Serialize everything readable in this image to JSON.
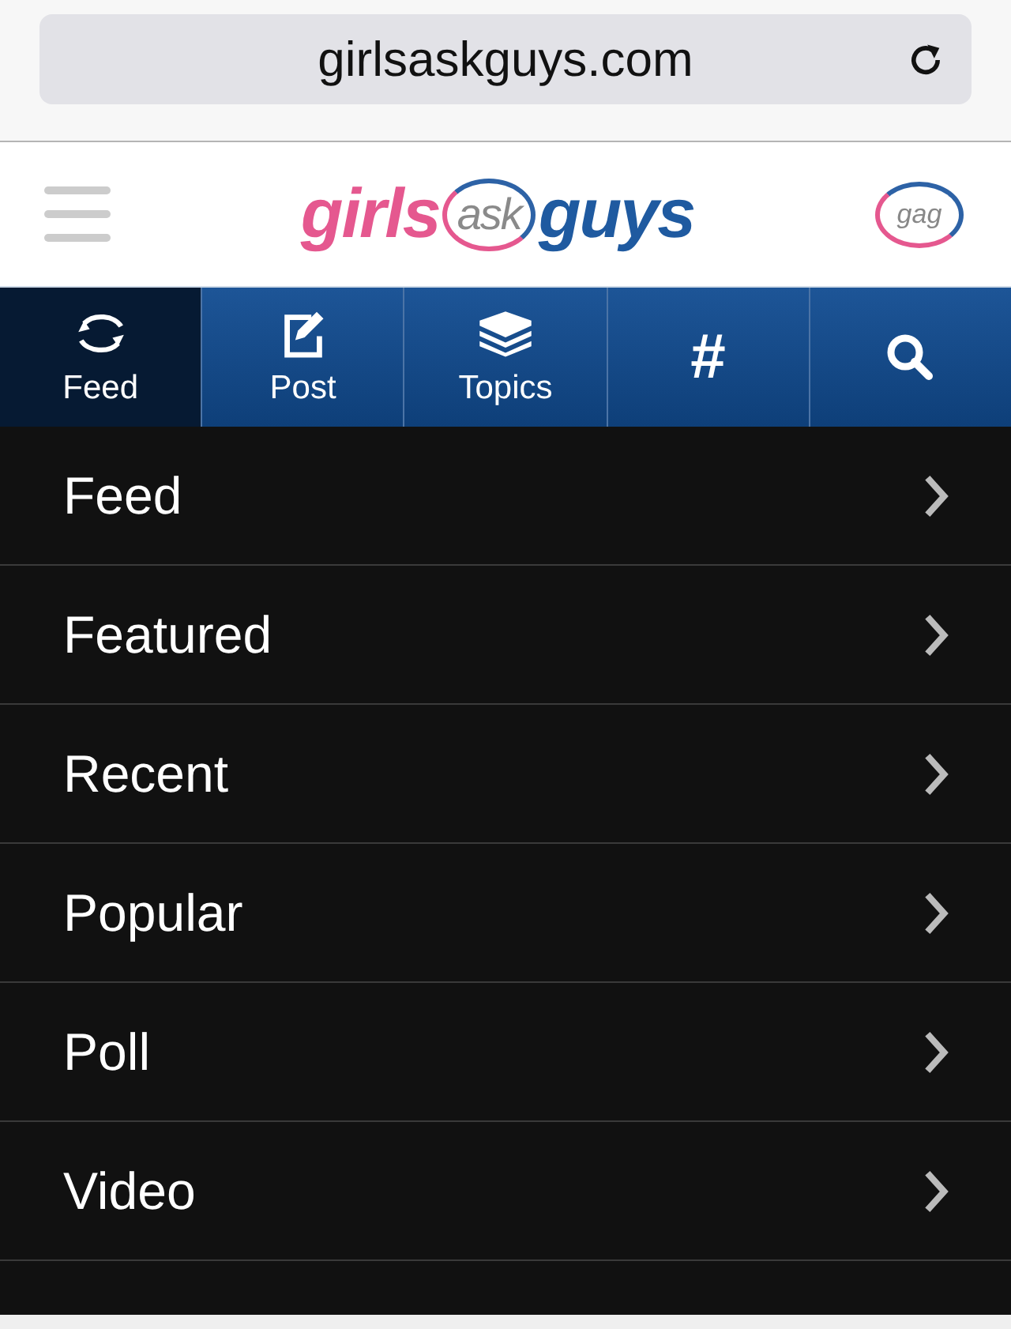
{
  "address_bar": {
    "url": "girlsaskguys.com"
  },
  "header": {
    "logo": {
      "part_1": "girls",
      "part_2": "ask",
      "part_3": "guys"
    },
    "badge": "gag"
  },
  "tabs": [
    {
      "kind": "feed",
      "label": "Feed",
      "selected": true
    },
    {
      "kind": "post",
      "label": "Post",
      "selected": false
    },
    {
      "kind": "topics",
      "label": "Topics",
      "selected": false
    },
    {
      "kind": "hash",
      "symbol": "#",
      "selected": false
    },
    {
      "kind": "search",
      "selected": false
    }
  ],
  "menu": {
    "items": [
      {
        "label": "Feed"
      },
      {
        "label": "Featured"
      },
      {
        "label": "Recent"
      },
      {
        "label": "Popular"
      },
      {
        "label": "Poll"
      },
      {
        "label": "Video"
      }
    ]
  }
}
